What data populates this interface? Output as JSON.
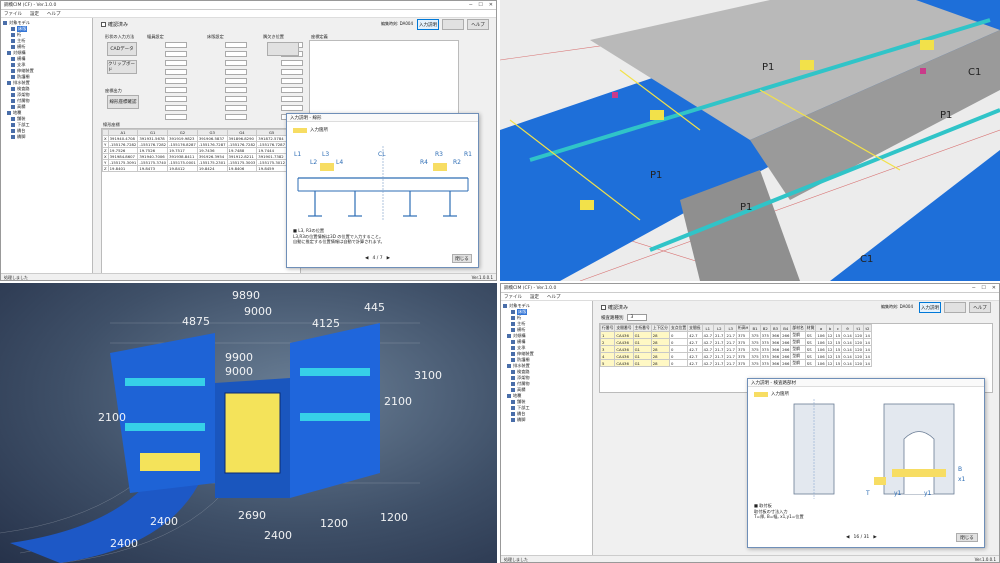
{
  "top_left": {
    "window_title": "鋼橋CIM (CF) - Ver.1.0.0",
    "menu": [
      "ファイル",
      "設定",
      "ヘルプ"
    ],
    "tree": [
      {
        "label": "対象モデル",
        "selected": false
      },
      {
        "label": "床版",
        "selected": true
      },
      {
        "label": "桁",
        "selected": false
      },
      {
        "label": "主桁",
        "selected": false
      },
      {
        "label": "横桁",
        "selected": false
      },
      {
        "label": "対傾構",
        "selected": false
      },
      {
        "label": "横構",
        "selected": false
      },
      {
        "label": "支承",
        "selected": false
      },
      {
        "label": "伸縮装置",
        "selected": false
      },
      {
        "label": "防護柵",
        "selected": false
      },
      {
        "label": "排水装置",
        "selected": false
      },
      {
        "label": "検査路",
        "selected": false
      },
      {
        "label": "添架物",
        "selected": false
      },
      {
        "label": "付属物",
        "selected": false
      },
      {
        "label": "高欄",
        "selected": false
      },
      {
        "label": "地覆",
        "selected": false
      },
      {
        "label": "舗装",
        "selected": false
      },
      {
        "label": "下部工",
        "selected": false
      },
      {
        "label": "橋台",
        "selected": false
      },
      {
        "label": "橋脚",
        "selected": false
      }
    ],
    "confirm_label": "確認済み",
    "info_label": "編集時刻: DA004",
    "btn_input_help": "入力説明",
    "btn_disabled": "",
    "btn_help": "ヘルプ",
    "section_headers": [
      "形状の入力方法",
      "幅員設定",
      "床版設定",
      "隅欠き位置",
      "座標定義"
    ],
    "cad_import_button": "CADデータ",
    "clip_import_button": "クリップボード",
    "section_output": "座標出力",
    "coord_confirm_button": "線形座標確認",
    "grid_header": "線形座標",
    "grid_columns": [
      "",
      "A1",
      "G1",
      "G2",
      "G3",
      "G4",
      "G5"
    ],
    "grid_rows": [
      [
        "X",
        "391940.4708",
        "391931.5678",
        "391919.9823",
        "391906.5837",
        "391896.8290",
        "391872.5784"
      ],
      [
        "Y",
        "-155176.7282",
        "-155176.7282",
        "-155176.8287",
        "-155176.7287",
        "-155176.7282",
        "-155176.7287"
      ],
      [
        "Z",
        "19.7526",
        "19.7526",
        "19.7517",
        "19.7436",
        "19.7488",
        "19.7444"
      ],
      [
        "X",
        "391984.8607",
        "391940.7006",
        "391938.8411",
        "391926.3954",
        "391912.8211",
        "391901.7382"
      ],
      [
        "Y",
        "-155175.3091",
        "-155175.3740",
        "-155175.0001",
        "-155175.2301",
        "-155175.3003",
        "-155175.3012"
      ],
      [
        "Z",
        "19.8401",
        "19.8473",
        "19.8412",
        "19.8424",
        "19.8406",
        "19.8459"
      ]
    ],
    "dialog_title": "入力説明 - 線形",
    "dialog_legend": "入力箇所",
    "dialog_labels": [
      "L1",
      "L2",
      "L3",
      "L4",
      "CL",
      "R4",
      "R3",
      "R2",
      "R1"
    ],
    "dialog_note": "■ L3, R3の位置\nL3,R3の位置情報は3D の位置で入力すること。\n自動に推定する位置情報は自動で計算されます。",
    "dialog_page": "4 / 7",
    "dialog_close": "閉じる",
    "status_left": "処理しました",
    "status_version": "Ver.1.0.0.1"
  },
  "top_right": {
    "labels": [
      "P1",
      "C1",
      "P1",
      "C1",
      "P1",
      "P1"
    ]
  },
  "bottom_left": {
    "dimensions_top": [
      "9890",
      "9000",
      "4875",
      "445",
      "4125"
    ],
    "dimensions_mid": [
      "9900",
      "9000",
      "2100"
    ],
    "dimensions_side": [
      "2100",
      "3100"
    ],
    "dimensions_bottom": [
      "2400",
      "2400",
      "2690",
      "2400",
      "1200",
      "1200"
    ]
  },
  "bottom_right": {
    "window_title": "鋼橋CIM (CF) - Ver.1.0.0",
    "menu": [
      "ファイル",
      "設定",
      "ヘルプ"
    ],
    "confirm_label": "確認済み",
    "filter_label": "検査路種別",
    "filter_value": "3",
    "info_label": "編集時刻: DA004",
    "btn_input_help": "入力説明",
    "btn_disabled": "",
    "btn_help": "ヘルプ",
    "grid_columns": [
      "行番号",
      "支間番号",
      "主桁番号",
      "上下区分",
      "支点位置",
      "支間長",
      "L1",
      "L2",
      "L3",
      "桁高H",
      "B1",
      "B2",
      "B3",
      "B4",
      "部材名",
      "材質",
      "a",
      "b",
      "c",
      "θ",
      "t1",
      "t2"
    ],
    "grid_rows": [
      [
        "1",
        "CA436",
        "G1",
        "28",
        "0",
        "42.7",
        "42.7",
        "21.7",
        "21.7",
        "375",
        "375",
        "375",
        "366",
        "266",
        "型鋼",
        "SS",
        "106",
        "12",
        "15",
        "0.14",
        "120",
        "14"
      ],
      [
        "2",
        "CA436",
        "G1",
        "28",
        "0",
        "42.7",
        "42.7",
        "21.7",
        "21.7",
        "375",
        "375",
        "375",
        "366",
        "266",
        "型鋼",
        "SS",
        "106",
        "12",
        "15",
        "0.14",
        "120",
        "14"
      ],
      [
        "3",
        "CA436",
        "G1",
        "28",
        "0",
        "42.7",
        "42.7",
        "21.7",
        "21.7",
        "375",
        "375",
        "375",
        "366",
        "266",
        "型鋼",
        "SS",
        "106",
        "12",
        "15",
        "0.14",
        "120",
        "14"
      ],
      [
        "4",
        "CA436",
        "G1",
        "28",
        "0",
        "42.7",
        "42.7",
        "21.7",
        "21.7",
        "375",
        "375",
        "375",
        "366",
        "266",
        "型鋼",
        "SS",
        "106",
        "12",
        "15",
        "0.14",
        "120",
        "14"
      ],
      [
        "5",
        "CA436",
        "G1",
        "28",
        "0",
        "42.7",
        "42.7",
        "21.7",
        "21.7",
        "375",
        "375",
        "375",
        "366",
        "266",
        "型鋼",
        "SS",
        "106",
        "12",
        "15",
        "0.14",
        "120",
        "14"
      ]
    ],
    "dialog_title": "入力説明 - 検査路部材",
    "dialog_legend": "入力箇所",
    "dialog_letters": [
      "B",
      "T",
      "y1",
      "x1",
      "y1"
    ],
    "dialog_note": "■ 取付板\n取付板の寸法入力\nT=厚, B=幅, x1,y1=位置",
    "dialog_page": "16 / 31",
    "dialog_close": "閉じる",
    "status_left": "処理しました",
    "status_version": "Ver.1.0.0.1"
  }
}
